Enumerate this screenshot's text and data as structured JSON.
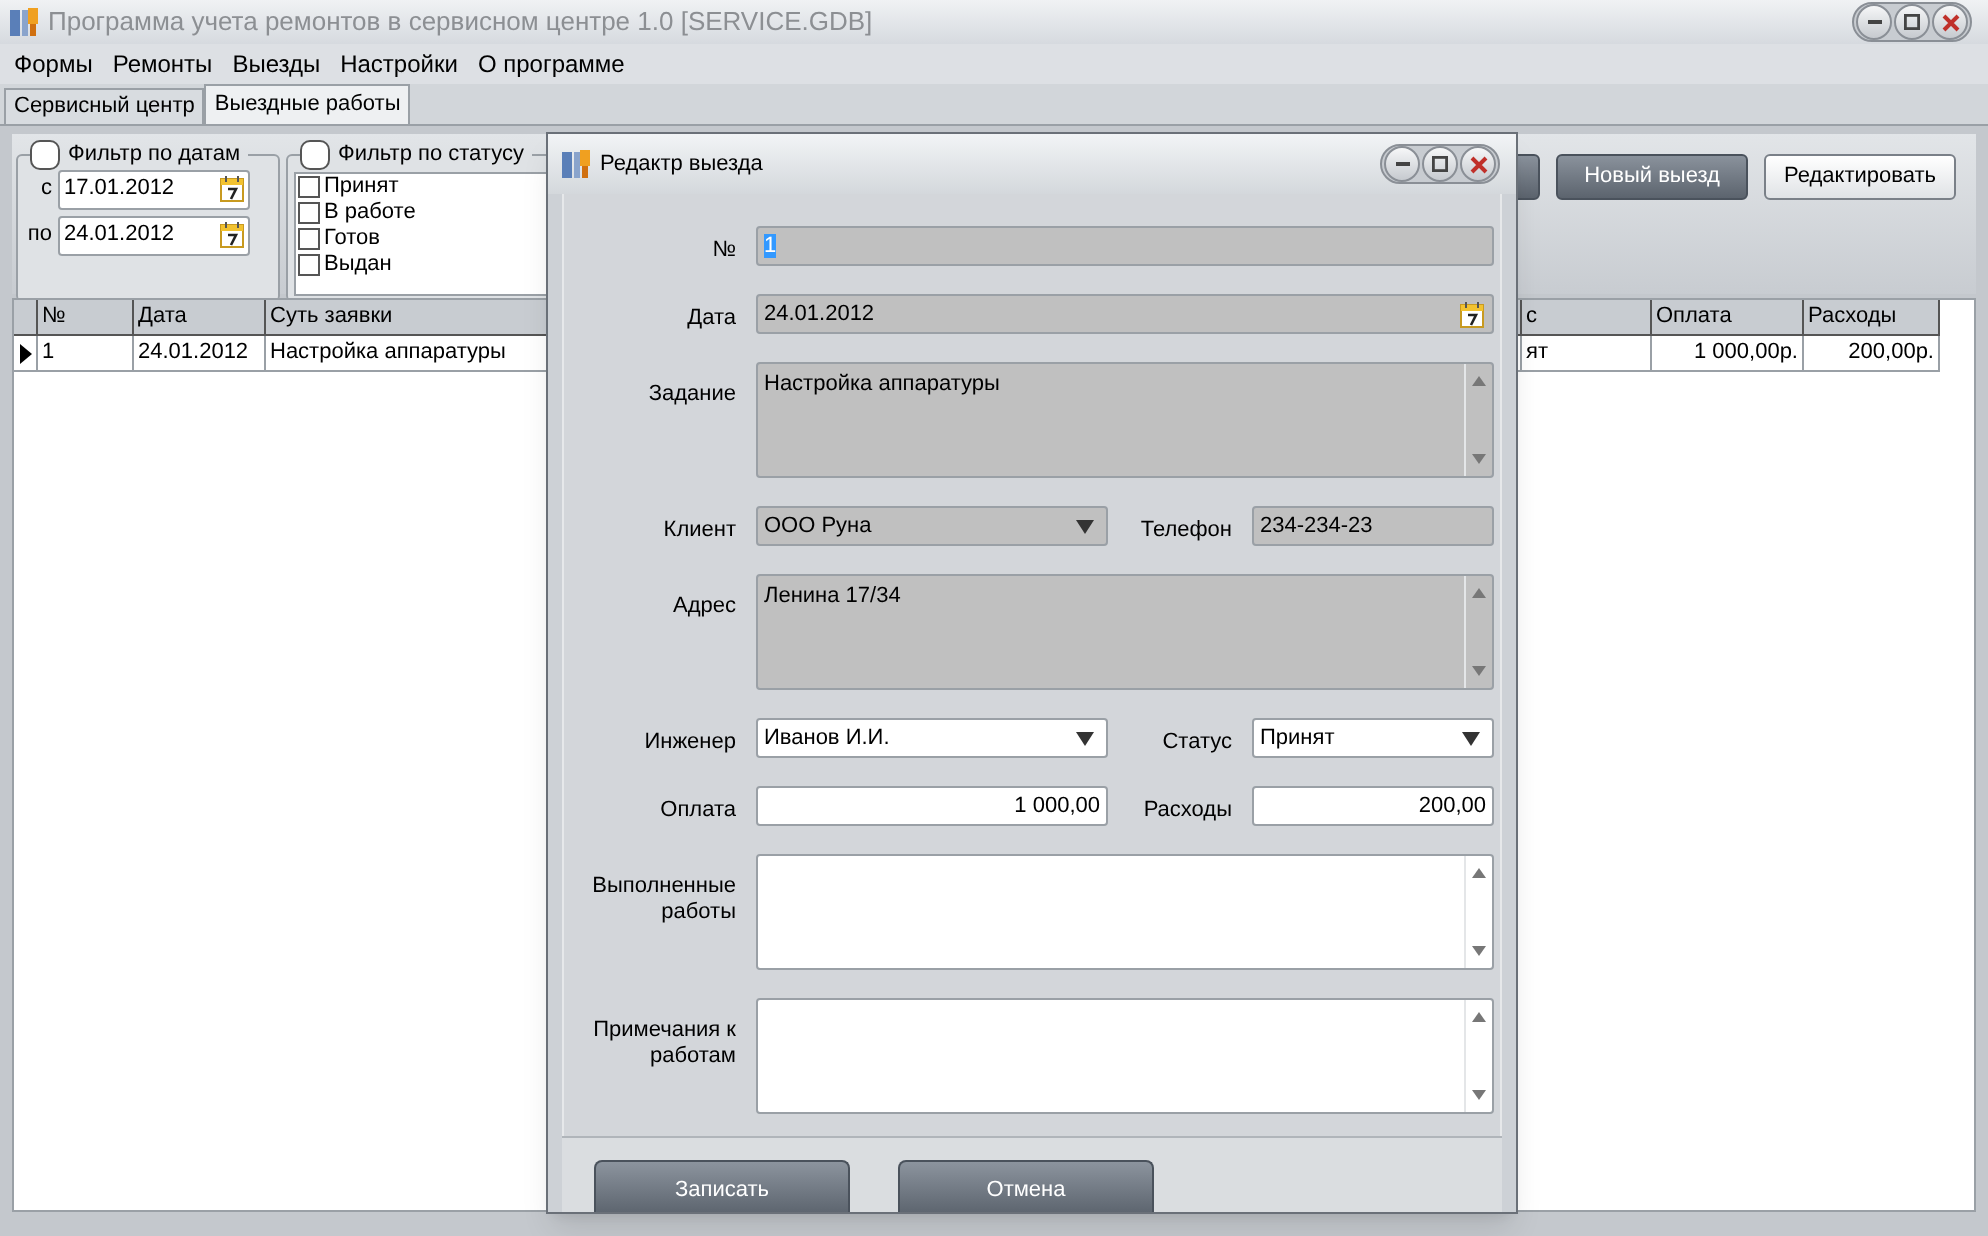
{
  "window": {
    "title": "Программа учета ремонтов в сервисном центре 1.0 [SERVICE.GDB]"
  },
  "menu": [
    "Формы",
    "Ремонты",
    "Выезды",
    "Настройки",
    "О программе"
  ],
  "tabs": [
    {
      "label": "Сервисный центр",
      "selected": false
    },
    {
      "label": "Выездные работы",
      "selected": true
    }
  ],
  "date_filter": {
    "title": "Фильтр по датам",
    "checked": false,
    "from_label": "с",
    "from": "17.01.2012",
    "to_label": "по",
    "to": "24.01.2012"
  },
  "status_filter": {
    "title": "Фильтр по статусу",
    "checked": false,
    "options": [
      {
        "label": "Принят",
        "checked": false
      },
      {
        "label": "В работе",
        "checked": false
      },
      {
        "label": "Готов",
        "checked": false
      },
      {
        "label": "Выдан",
        "checked": false
      }
    ]
  },
  "toolbar_buttons": [
    "Новый выезд",
    "Редактировать"
  ],
  "table": {
    "columns": [
      "№",
      "Дата",
      "Суть заявки",
      "с",
      "Оплата",
      "Расходы"
    ],
    "rows": [
      {
        "selected": true,
        "cells": [
          "1",
          "24.01.2012",
          "Настройка аппаратуры",
          "ят",
          "1 000,00р.",
          "200,00р."
        ]
      }
    ]
  },
  "dialog": {
    "title": "Редактр выезда",
    "rows": [
      {
        "fields": [
          {
            "label": "№",
            "kind": "text",
            "value": "1",
            "readonly": true,
            "text_selected": true
          }
        ]
      },
      {
        "fields": [
          {
            "label": "Дата",
            "kind": "date",
            "value": "24.01.2012",
            "readonly": true,
            "text_selected": false
          }
        ]
      },
      {
        "fields": [
          {
            "label": "Задание",
            "kind": "memo",
            "value": "Настройка аппаратуры",
            "readonly": true,
            "text_selected": false
          }
        ]
      },
      {
        "fields": [
          {
            "label": "Клиент",
            "kind": "combo",
            "value": "ООО Руна",
            "readonly": true,
            "text_selected": false
          },
          {
            "label": "Телефон",
            "kind": "text",
            "value": "234-234-23",
            "readonly": true,
            "text_selected": false
          }
        ]
      },
      {
        "fields": [
          {
            "label": "Адрес",
            "kind": "memo",
            "value": "Ленина 17/34",
            "readonly": true,
            "text_selected": false
          }
        ]
      },
      {
        "fields": [
          {
            "label": "Инженер",
            "kind": "combo",
            "value": "Иванов И.И.",
            "readonly": false,
            "text_selected": false
          },
          {
            "label": "Статус",
            "kind": "combo",
            "value": "Принят",
            "readonly": false,
            "text_selected": false
          }
        ]
      },
      {
        "fields": [
          {
            "label": "Оплата",
            "kind": "number",
            "value": "1 000,00",
            "readonly": false,
            "text_selected": false
          },
          {
            "label": "Расходы",
            "kind": "number",
            "value": "200,00",
            "readonly": false,
            "text_selected": false
          }
        ]
      },
      {
        "fields": [
          {
            "label": "Выполненные работы",
            "kind": "memo",
            "readonly": false
          }
        ]
      },
      {
        "fields": [
          {
            "label": "Примечания к работам",
            "kind": "memo",
            "readonly": false
          }
        ]
      }
    ],
    "buttons": [
      "Записать",
      "Отмена"
    ]
  }
}
